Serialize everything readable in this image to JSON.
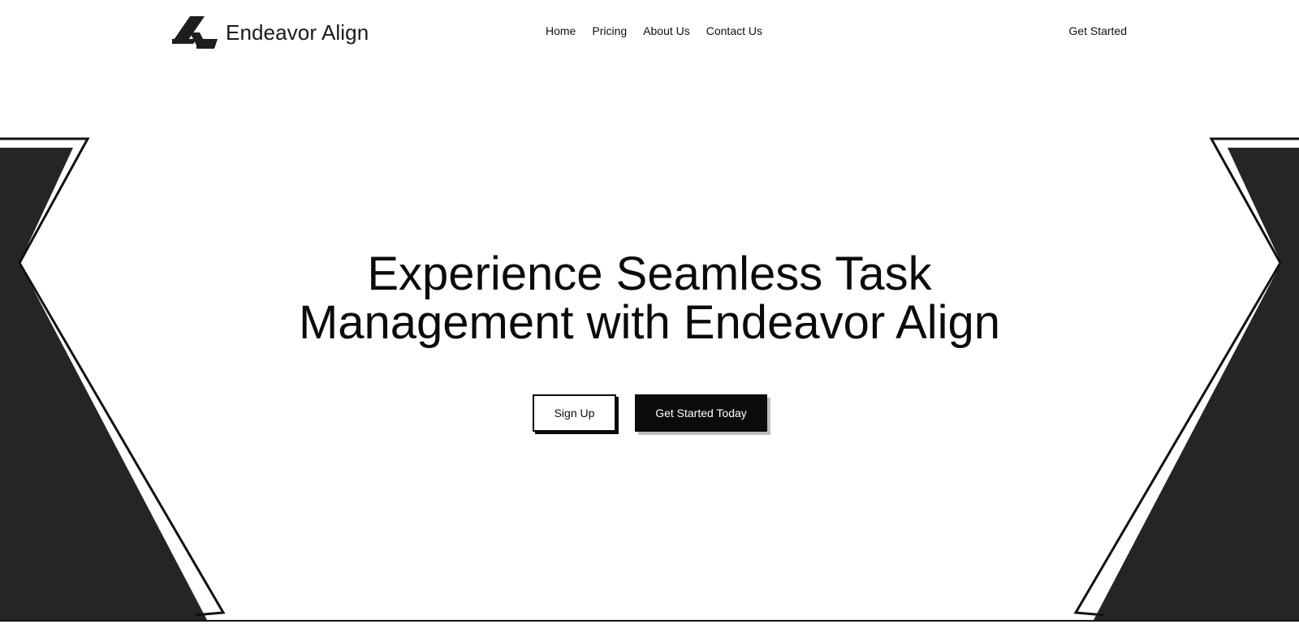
{
  "brand": {
    "name": "Endeavor Align",
    "logo_icon": "endeavor-align-logo-icon"
  },
  "nav": {
    "items": [
      {
        "label": "Home"
      },
      {
        "label": "Pricing"
      },
      {
        "label": "About Us"
      },
      {
        "label": "Contact Us"
      }
    ],
    "cta_label": "Get Started"
  },
  "hero": {
    "title_line_1": "Experience Seamless Task",
    "title_line_2": "Management with Endeavor Align",
    "secondary_button": "Sign Up",
    "primary_button": "Get Started Today"
  },
  "colors": {
    "text": "#0b0b0e",
    "shape_fill": "#252525",
    "background": "#ffffff",
    "button_shadow": "#bdbdbd"
  }
}
